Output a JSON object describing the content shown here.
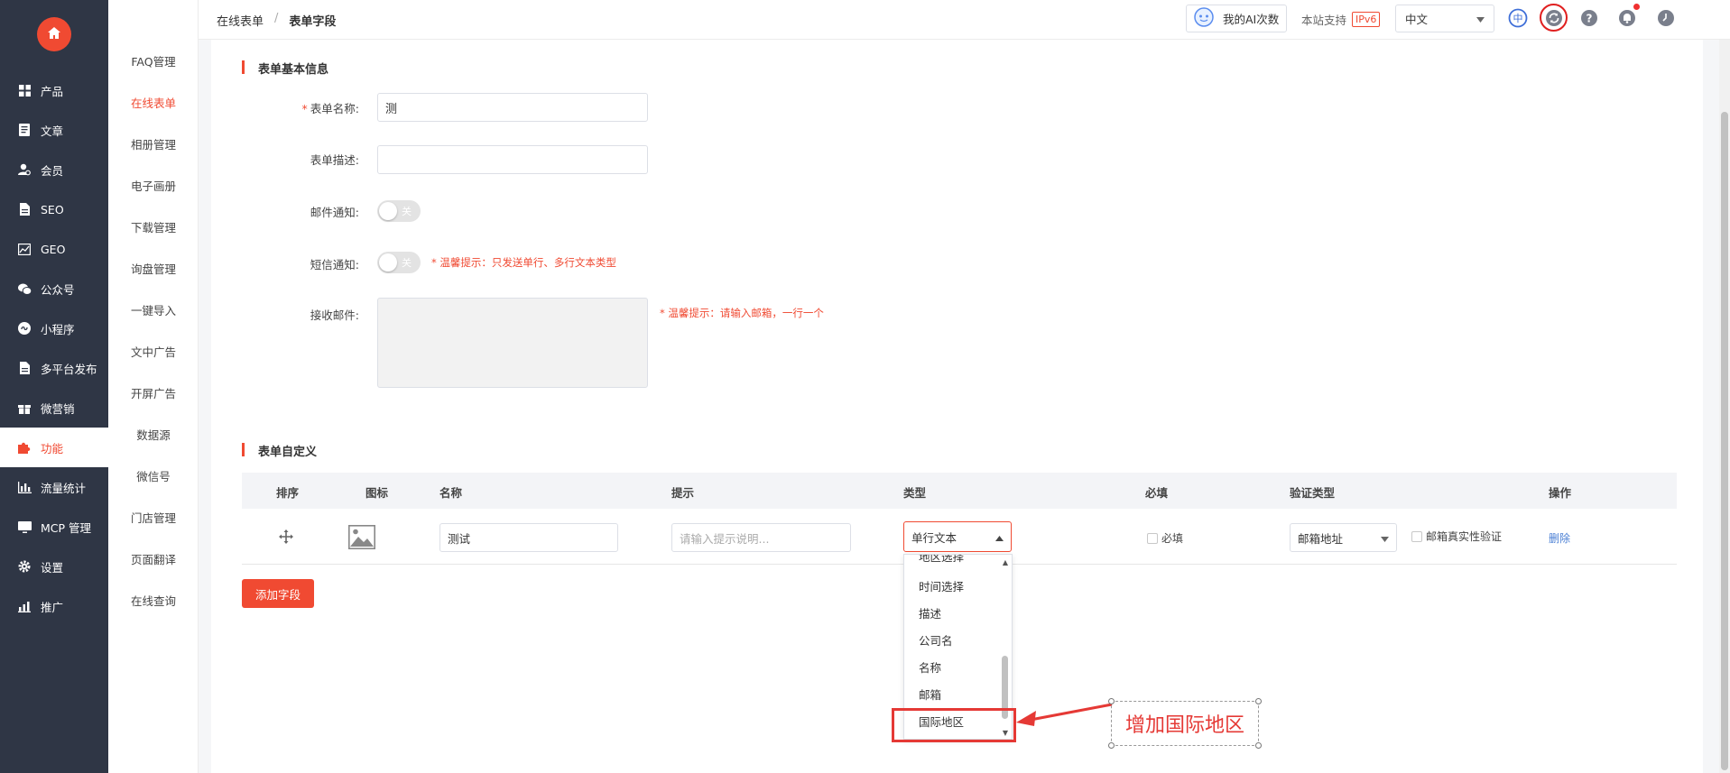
{
  "sidebar": {
    "home_icon": "home-icon",
    "items": [
      {
        "label": "产品",
        "icon": "grid-icon"
      },
      {
        "label": "文章",
        "icon": "document-icon"
      },
      {
        "label": "会员",
        "icon": "user-icon"
      },
      {
        "label": "SEO",
        "icon": "file-icon"
      },
      {
        "label": "GEO",
        "icon": "trend-chart-icon"
      },
      {
        "label": "公众号",
        "icon": "wechat-icon"
      },
      {
        "label": "小程序",
        "icon": "miniprogram-icon"
      },
      {
        "label": "多平台发布",
        "icon": "file-icon"
      },
      {
        "label": "微营销",
        "icon": "gift-icon"
      },
      {
        "label": "功能",
        "icon": "puzzle-icon",
        "active": true
      },
      {
        "label": "流量统计",
        "icon": "bar-chart-icon"
      },
      {
        "label": "MCP 管理",
        "icon": "monitor-icon"
      },
      {
        "label": "设置",
        "icon": "gear-icon"
      },
      {
        "label": "推广",
        "icon": "chart-icon"
      }
    ]
  },
  "submenu": {
    "items": [
      "FAQ管理",
      "在线表单",
      "相册管理",
      "电子画册",
      "下载管理",
      "询盘管理",
      "一键导入",
      "文中广告",
      "开屏广告",
      "数据源",
      "微信号",
      "门店管理",
      "页面翻译",
      "在线查询"
    ],
    "active_index": 1
  },
  "header": {
    "breadcrumb": [
      "在线表单",
      "/",
      "表单字段"
    ],
    "ai_button": "我的AI次数",
    "ipv6_text": "本站支持",
    "ipv6_badge": "IPv6",
    "language": "中文",
    "icons": [
      "language-icon",
      "refresh-icon",
      "help-icon",
      "bell-icon",
      "clock-icon"
    ]
  },
  "form_basic": {
    "section_title": "表单基本信息",
    "name_label": "表单名称:",
    "name_value": "测",
    "desc_label": "表单描述:",
    "desc_value": "",
    "email_notify_label": "邮件通知:",
    "email_notify_state": "关",
    "sms_notify_label": "短信通知:",
    "sms_notify_state": "关",
    "sms_hint": "* 温馨提示：只发送单行、多行文本类型",
    "recv_email_label": "接收邮件:",
    "recv_email_hint": "* 温馨提示：请输入邮箱，一行一个"
  },
  "form_custom": {
    "section_title": "表单自定义",
    "columns": [
      "排序",
      "图标",
      "名称",
      "提示",
      "类型",
      "必填",
      "验证类型",
      "操作"
    ],
    "row": {
      "drag_icon": "move-icon",
      "image_icon": "image-icon",
      "name": "测试",
      "hint_placeholder": "请输入提示说明...",
      "type": "单行文本",
      "required_label": "必填",
      "verify_type": "邮箱地址",
      "real_verify_label": "邮箱真实性验证",
      "delete_label": "删除"
    },
    "add_button": "添加字段"
  },
  "type_dropdown": {
    "options": [
      "地区选择",
      "时间选择",
      "描述",
      "公司名",
      "名称",
      "邮箱",
      "国际地区"
    ]
  },
  "annotation": {
    "text": "增加国际地区",
    "color": "#e53935"
  },
  "colors": {
    "accent": "#f04a32",
    "sidebar_bg": "#2f3645",
    "link": "#4a7fd4"
  }
}
